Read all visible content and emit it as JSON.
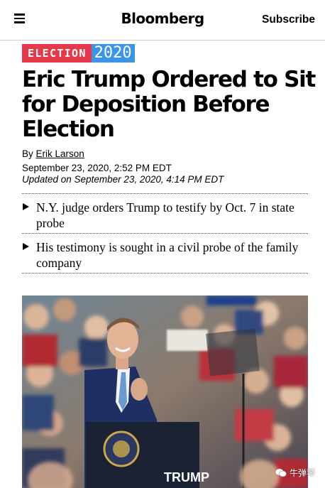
{
  "header": {
    "logo": "Bloomberg",
    "subscribe_label": "Subscribe"
  },
  "badge": {
    "word": "ELECTION",
    "year": "2020",
    "colors": {
      "word_bg": "#e63a4a",
      "year_bg": "#3a95e6"
    }
  },
  "article": {
    "headline": "Eric Trump Ordered to Sit for Deposition Before Election",
    "byline_prefix": "By",
    "author": "Erik Larson",
    "published": "September 23, 2020, 2:52 PM EDT",
    "updated": "Updated on September 23, 2020, 4:14 PM EDT",
    "takeaways": [
      "N.Y. judge orders Trump to testify by Oct. 7 in state probe",
      "His testimony is sought in a civil probe of the family company"
    ]
  },
  "photo": {
    "podium_sign": "TRUMP"
  },
  "watermark": {
    "text": "牛弹琴"
  }
}
